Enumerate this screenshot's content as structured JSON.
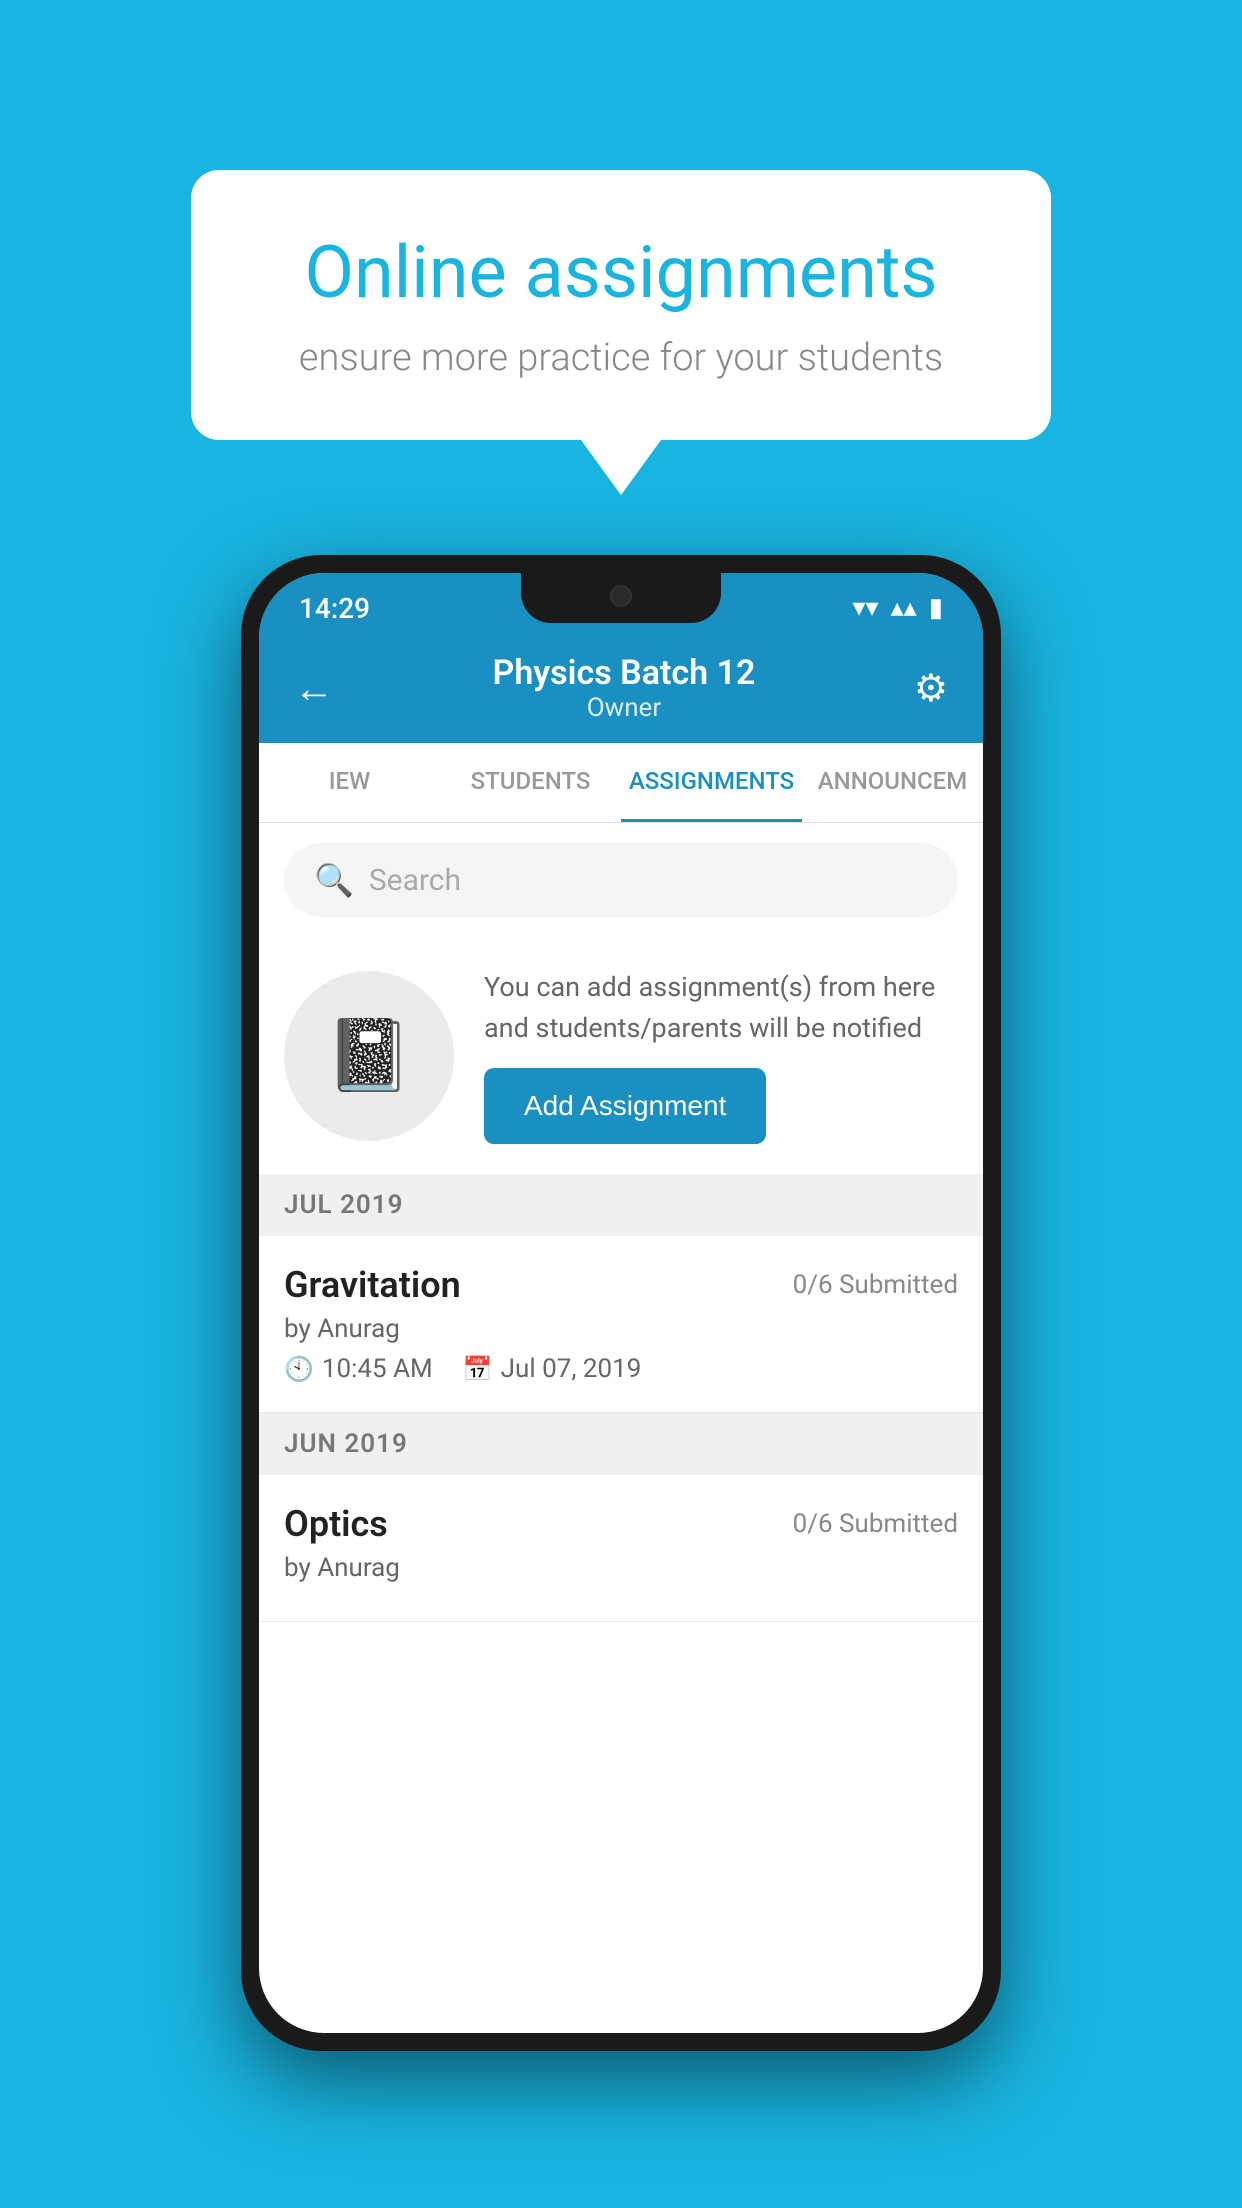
{
  "background": {
    "color": "#19b4e0"
  },
  "speech_bubble": {
    "title": "Online assignments",
    "subtitle": "ensure more practice for your students"
  },
  "phone": {
    "status_bar": {
      "time": "14:29",
      "wifi_icon": "▾",
      "signal_icon": "▴",
      "battery_icon": "▮"
    },
    "header": {
      "back_label": "←",
      "title": "Physics Batch 12",
      "subtitle": "Owner",
      "settings_icon": "⚙"
    },
    "tabs": [
      {
        "label": "IEW",
        "active": false
      },
      {
        "label": "STUDENTS",
        "active": false
      },
      {
        "label": "ASSIGNMENTS",
        "active": true
      },
      {
        "label": "ANNOUNCEM",
        "active": false
      }
    ],
    "search": {
      "placeholder": "Search"
    },
    "promo": {
      "text": "You can add assignment(s) from here and students/parents will be notified",
      "button_label": "Add Assignment"
    },
    "sections": [
      {
        "label": "JUL 2019",
        "assignments": [
          {
            "name": "Gravitation",
            "submitted": "0/6 Submitted",
            "by": "by Anurag",
            "time": "10:45 AM",
            "date": "Jul 07, 2019"
          }
        ]
      },
      {
        "label": "JUN 2019",
        "assignments": [
          {
            "name": "Optics",
            "submitted": "0/6 Submitted",
            "by": "by Anurag",
            "time": "",
            "date": ""
          }
        ]
      }
    ]
  }
}
